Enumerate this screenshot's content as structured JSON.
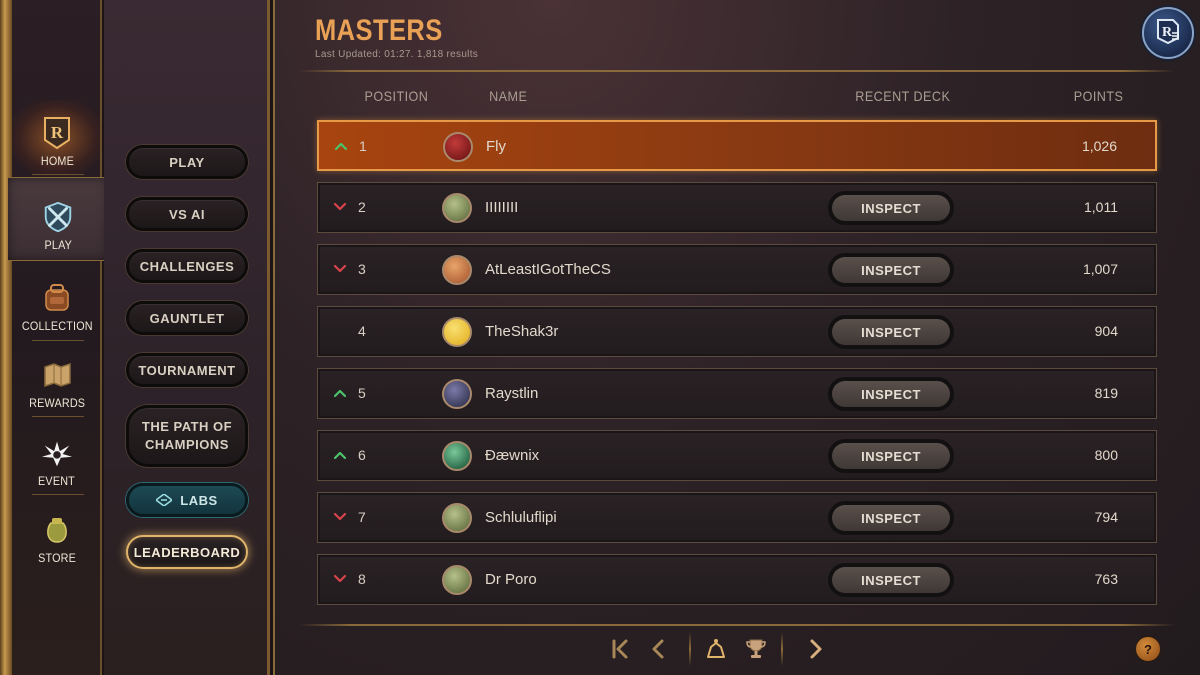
{
  "nav": {
    "items": [
      {
        "label": "HOME",
        "icon": "home-r-icon"
      },
      {
        "label": "PLAY",
        "icon": "play-crossed-swords-icon"
      },
      {
        "label": "COLLECTION",
        "icon": "backpack-icon"
      },
      {
        "label": "REWARDS",
        "icon": "scroll-map-icon"
      },
      {
        "label": "EVENT",
        "icon": "event-burst-icon"
      },
      {
        "label": "STORE",
        "icon": "coin-bag-icon"
      }
    ]
  },
  "play_menu": {
    "items": [
      "PLAY",
      "VS AI",
      "CHALLENGES",
      "GAUNTLET",
      "TOURNAMENT",
      "THE PATH OF CHAMPIONS",
      "LABS",
      "LEADERBOARD"
    ]
  },
  "leaderboard": {
    "title": "MASTERS",
    "subtitle": "Last Updated: 01:27. 1,818 results",
    "columns": {
      "position": "POSITION",
      "name": "NAME",
      "recent_deck": "RECENT DECK",
      "points": "POINTS"
    },
    "inspect_label": "INSPECT",
    "rows": [
      {
        "position": "1",
        "name": "Fly",
        "points": "1,026",
        "trend": "up",
        "has_deck": false
      },
      {
        "position": "2",
        "name": "IIIIIIII",
        "points": "1,011",
        "trend": "down",
        "has_deck": true
      },
      {
        "position": "3",
        "name": "AtLeastIGotTheCS",
        "points": "1,007",
        "trend": "down",
        "has_deck": true
      },
      {
        "position": "4",
        "name": "TheShak3r",
        "points": "904",
        "trend": "none",
        "has_deck": true
      },
      {
        "position": "5",
        "name": "Raystlin",
        "points": "819",
        "trend": "up",
        "has_deck": true
      },
      {
        "position": "6",
        "name": "Đæwnix",
        "points": "800",
        "trend": "up",
        "has_deck": true
      },
      {
        "position": "7",
        "name": "Schluluflipi",
        "points": "794",
        "trend": "down",
        "has_deck": true
      },
      {
        "position": "8",
        "name": "Dr Poro",
        "points": "763",
        "trend": "down",
        "has_deck": true
      }
    ]
  },
  "help_label": "?",
  "colors": {
    "accent_orange": "#e9a156",
    "trend_up": "#4cc46a",
    "trend_down": "#d9434a",
    "highlight_row": "#a8440f"
  }
}
